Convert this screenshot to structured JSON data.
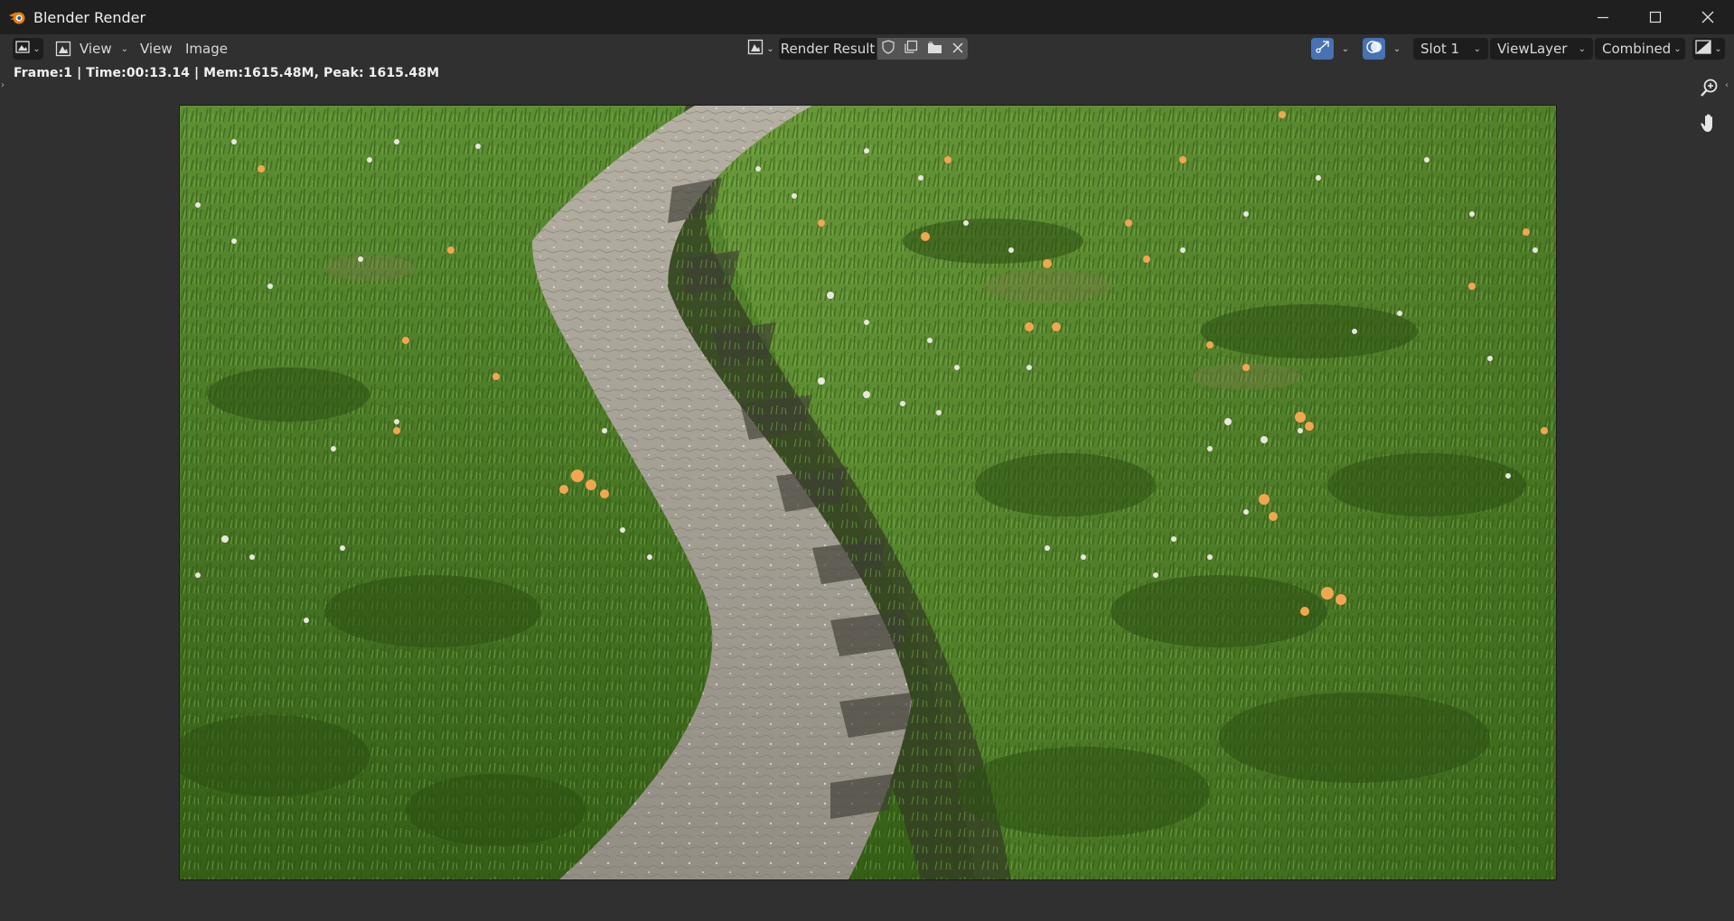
{
  "window": {
    "title": "Blender Render",
    "logo_icon": "blender-logo-icon",
    "controls": [
      "minimize-icon",
      "maximize-icon",
      "close-icon"
    ]
  },
  "header": {
    "editor_type_icon": "image-editor-icon",
    "view_menu_label": "View",
    "view_label": "View",
    "image_label": "Image",
    "image_name": "Render Result",
    "image_buttons": [
      "fake-user-shield-icon",
      "duplicate-image-icon",
      "open-image-folder-icon",
      "close-icon"
    ],
    "slot": "Slot 1",
    "view_layer": "ViewLayer",
    "pass": "Combined",
    "accent_color": "#4772b3"
  },
  "status": {
    "text": "Frame:1 | Time:00:13.14 | Mem:1615.48M, Peak: 1615.48M"
  },
  "viewport_tools": [
    "zoom-icon",
    "pan-hand-icon"
  ],
  "render": {
    "description_colors": {
      "grass_dark": "#2f5a14",
      "grass_light": "#5c8d34",
      "path": "#a29d92",
      "shadow": "#3b3a33",
      "flower_orange": "#f2a650",
      "flower_white": "#e8e6df"
    }
  }
}
